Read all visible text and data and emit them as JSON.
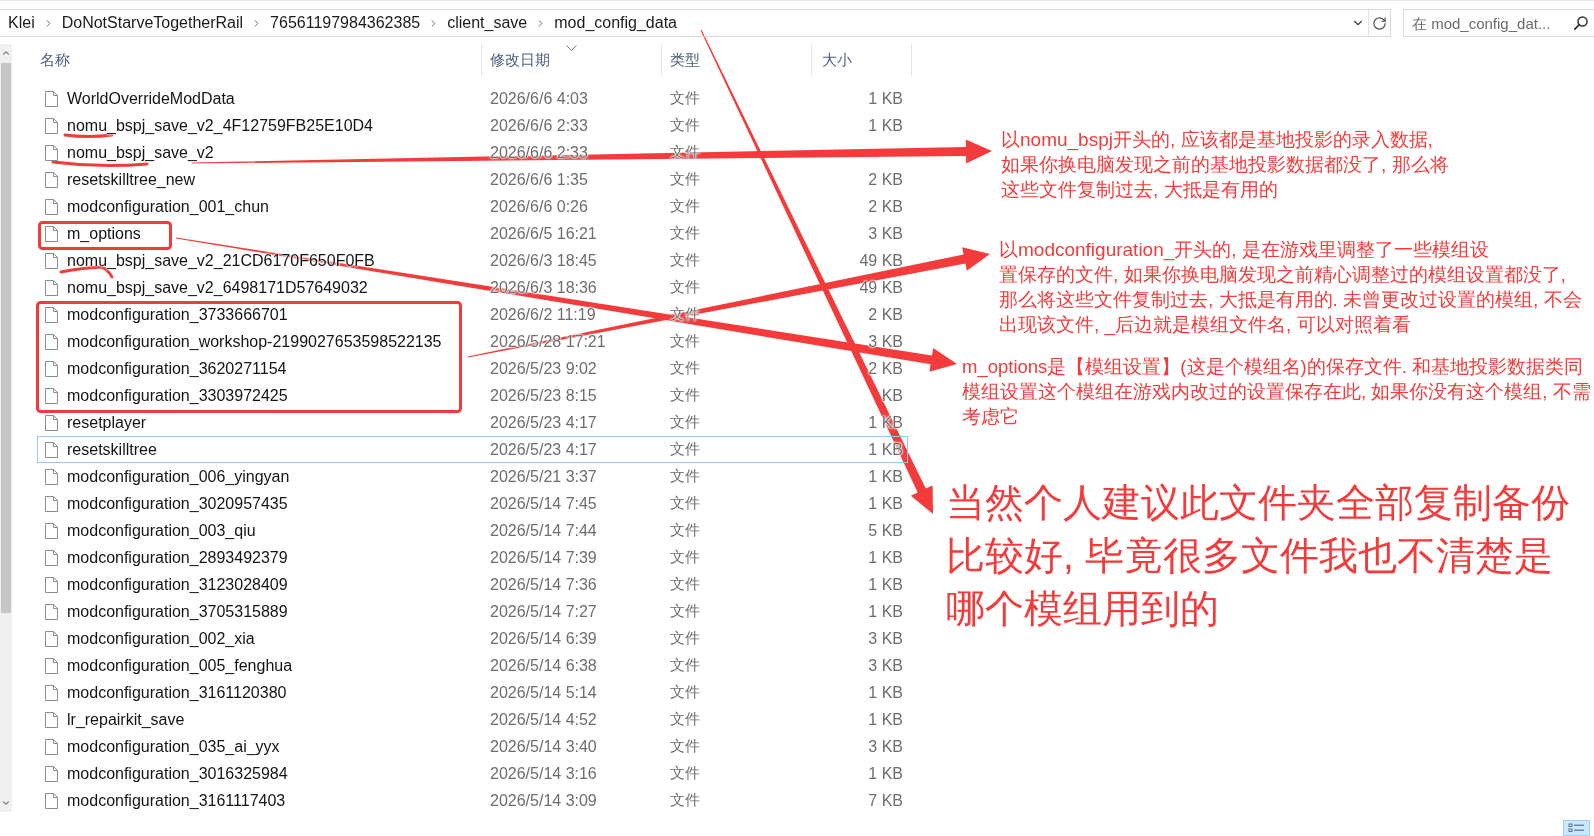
{
  "address_bar": {
    "breadcrumbs": [
      "Klei",
      "DoNotStarveTogetherRail",
      "76561197984362385",
      "client_save",
      "mod_config_data"
    ]
  },
  "search": {
    "placeholder": "在 mod_config_dat..."
  },
  "file_list": {
    "columns": [
      {
        "label": "名称",
        "sorted": false
      },
      {
        "label": "修改日期",
        "sorted": true
      },
      {
        "label": "类型",
        "sorted": false
      },
      {
        "label": "大小",
        "sorted": false
      }
    ],
    "rows": [
      {
        "name": "WorldOverrideModData",
        "modified": "2026/6/6 4:03",
        "type": "文件",
        "size": "1 KB",
        "focused": false
      },
      {
        "name": "nomu_bspj_save_v2_4F12759FB25E10D4",
        "modified": "2026/6/6 2:33",
        "type": "文件",
        "size": "1 KB",
        "focused": false
      },
      {
        "name": "nomu_bspj_save_v2",
        "modified": "2026/6/6 2:33",
        "type": "文件",
        "focused": false
      },
      {
        "name": "resetskilltree_new",
        "modified": "2026/6/6 1:35",
        "type": "文件",
        "size": "2 KB",
        "focused": false
      },
      {
        "name": "modconfiguration_001_chun",
        "modified": "2026/6/6 0:26",
        "type": "文件",
        "size": "2 KB",
        "focused": false
      },
      {
        "name": "m_options",
        "modified": "2026/6/5 16:21",
        "type": "文件",
        "size": "3 KB",
        "focused": false
      },
      {
        "name": "nomu_bspj_save_v2_21CD6170F650F0FB",
        "modified": "2026/6/3 18:45",
        "type": "文件",
        "size": "49 KB",
        "focused": false
      },
      {
        "name": "nomu_bspj_save_v2_6498171D57649032",
        "modified": "2026/6/3 18:36",
        "type": "文件",
        "size": "49 KB",
        "focused": false
      },
      {
        "name": "modconfiguration_3733666701",
        "modified": "2026/6/2 11:19",
        "type": "文件",
        "size": "2 KB",
        "focused": false
      },
      {
        "name": "modconfiguration_workshop-2199027653598522135",
        "modified": "2026/5/28 17:21",
        "type": "文件",
        "size": "3 KB",
        "focused": false
      },
      {
        "name": "modconfiguration_3620271154",
        "modified": "2026/5/23 9:02",
        "type": "文件",
        "size": "2 KB",
        "focused": false
      },
      {
        "name": "modconfiguration_3303972425",
        "modified": "2026/5/23 8:15",
        "type": "文件",
        "size": "KB",
        "focused": false
      },
      {
        "name": "resetplayer",
        "modified": "2026/5/23 4:17",
        "type": "文件",
        "size": "1 KB",
        "focused": false
      },
      {
        "name": "resetskilltree",
        "modified": "2026/5/23 4:17",
        "type": "文件",
        "size": "1 KB",
        "focused": true
      },
      {
        "name": "modconfiguration_006_yingyan",
        "modified": "2026/5/21 3:37",
        "type": "文件",
        "size": "1 KB",
        "focused": false
      },
      {
        "name": "modconfiguration_3020957435",
        "modified": "2026/5/14 7:45",
        "type": "文件",
        "size": "1 KB",
        "focused": false
      },
      {
        "name": "modconfiguration_003_qiu",
        "modified": "2026/5/14 7:44",
        "type": "文件",
        "size": "5 KB",
        "focused": false
      },
      {
        "name": "modconfiguration_2893492379",
        "modified": "2026/5/14 7:39",
        "type": "文件",
        "size": "1 KB",
        "focused": false
      },
      {
        "name": "modconfiguration_3123028409",
        "modified": "2026/5/14 7:36",
        "type": "文件",
        "size": "1 KB",
        "focused": false
      },
      {
        "name": "modconfiguration_3705315889",
        "modified": "2026/5/14 7:27",
        "type": "文件",
        "size": "1 KB",
        "focused": false
      },
      {
        "name": "modconfiguration_002_xia",
        "modified": "2026/5/14 6:39",
        "type": "文件",
        "size": "3 KB",
        "focused": false
      },
      {
        "name": "modconfiguration_005_fenghua",
        "modified": "2026/5/14 6:38",
        "type": "文件",
        "size": "3 KB",
        "focused": false
      },
      {
        "name": "modconfiguration_3161120380",
        "modified": "2026/5/14 5:14",
        "type": "文件",
        "size": "1 KB",
        "focused": false
      },
      {
        "name": "lr_repairkit_save",
        "modified": "2026/5/14 4:52",
        "type": "文件",
        "size": "1 KB",
        "focused": false
      },
      {
        "name": "modconfiguration_035_ai_yyx",
        "modified": "2026/5/14 3:40",
        "type": "文件",
        "size": "3 KB",
        "focused": false
      },
      {
        "name": "modconfiguration_3016325984",
        "modified": "2026/5/14 3:16",
        "type": "文件",
        "size": "1 KB",
        "focused": false
      },
      {
        "name": "modconfiguration_3161117403",
        "modified": "2026/5/14 3:09",
        "type": "文件",
        "size": "7 KB",
        "focused": false
      }
    ]
  },
  "annotations": [
    {
      "kind": "note",
      "text": "以nomu_bspj开头的, 应该都是基地投影的录入数据,如果你换电脑发现之前的基地投影数据都没了, 那么将这些文件复制过去, 大抵是有用的"
    },
    {
      "kind": "note",
      "text": "以modconfiguration_开头的, 是在游戏里调整了一些模组设置保存的文件, 如果你换电脑发现之前精心调整过的模组设置都没了,那么将这些文件复制过去, 大抵是有用的. 未曾更改过设置的模组, 不会出现该文件, _后边就是模组文件名, 可以对照着看"
    },
    {
      "kind": "note",
      "text": "m_options是【模组设置】(这是个模组名)的保存文件. 和基地投影数据类同模组设置这个模组在游戏内改过的设置保存在此, 如果你没有这个模组, 不需考虑它"
    },
    {
      "kind": "headline",
      "text": "当然个人建议此文件夹全部复制备份比较好, 毕竟很多文件我也不清楚是哪个模组用到的"
    }
  ],
  "view_modes": [
    {
      "kind": "details",
      "selected": true
    }
  ]
}
